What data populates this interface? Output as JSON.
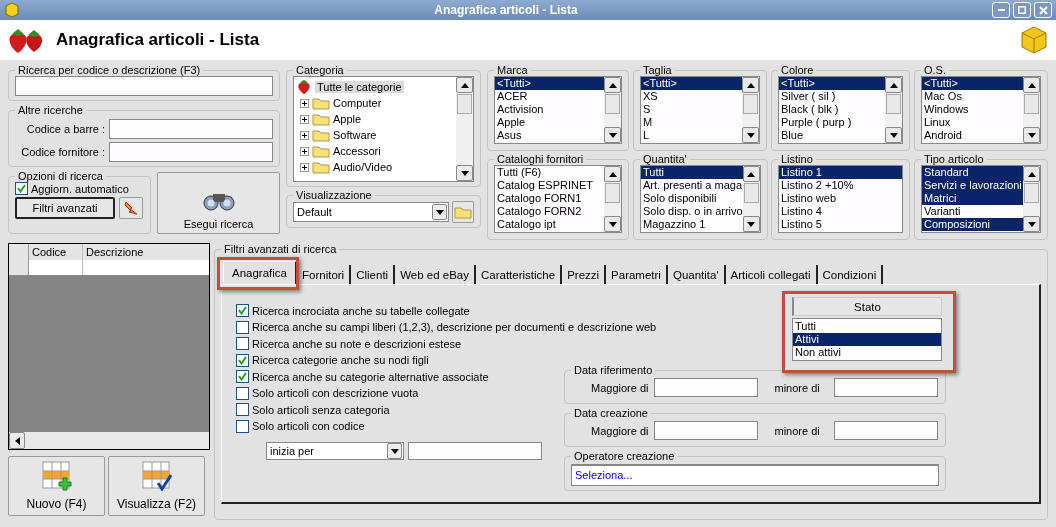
{
  "window": {
    "title": "Anagrafica articoli  - Lista"
  },
  "header": {
    "title": "Anagrafica articoli  - Lista"
  },
  "search": {
    "label": "Ricerca per codice o descrizione (F3)"
  },
  "other_searches": {
    "label": "Altre ricerche",
    "fields": [
      {
        "label": "Codice a barre :"
      },
      {
        "label": "Codice fornitore :"
      }
    ]
  },
  "options": {
    "label": "Opzioni di ricerca",
    "auto_update": {
      "label": "Aggiorn. automatico",
      "checked": true
    },
    "filters_button": "Filtri avanzati"
  },
  "run_button": "Esegui ricerca",
  "category": {
    "label": "Categoria",
    "root": {
      "label": "Tutte le categorie",
      "selected": true
    },
    "children": [
      {
        "label": "Computer",
        "expanded": false
      },
      {
        "label": "Apple",
        "expanded": false
      },
      {
        "label": "Software",
        "expanded": false
      },
      {
        "label": "Accessori",
        "expanded": false
      },
      {
        "label": "Audio/Video",
        "expanded": false
      }
    ]
  },
  "view": {
    "label": "Visualizzazione",
    "value": "Default"
  },
  "lists": [
    {
      "label": "Marca",
      "scrollable": true,
      "items": [
        {
          "label": "<Tutti>",
          "selected": true
        },
        {
          "label": "ACER",
          "selected": false
        },
        {
          "label": "Activision",
          "selected": false
        },
        {
          "label": "Apple",
          "selected": false
        },
        {
          "label": "Asus",
          "selected": false
        }
      ]
    },
    {
      "label": "Taglia",
      "scrollable": true,
      "items": [
        {
          "label": "<Tutti>",
          "selected": true
        },
        {
          "label": "XS",
          "selected": false
        },
        {
          "label": "S",
          "selected": false
        },
        {
          "label": "M",
          "selected": false
        },
        {
          "label": "L",
          "selected": false
        }
      ]
    },
    {
      "label": "Colore",
      "scrollable": true,
      "items": [
        {
          "label": "<Tutti>",
          "selected": true
        },
        {
          "label": "Silver ( sil )",
          "selected": false
        },
        {
          "label": "Black ( blk )",
          "selected": false
        },
        {
          "label": "Purple ( purp )",
          "selected": false
        },
        {
          "label": "Blue",
          "selected": false
        }
      ]
    },
    {
      "label": "O.S.",
      "scrollable": true,
      "items": [
        {
          "label": "<Tutti>",
          "selected": true
        },
        {
          "label": "Mac Os",
          "selected": false
        },
        {
          "label": "Windows",
          "selected": false
        },
        {
          "label": "Linux",
          "selected": false
        },
        {
          "label": "Android",
          "selected": false
        }
      ]
    },
    {
      "label": "Cataloghi fornitori",
      "scrollable": true,
      "items": [
        {
          "label": "Tutti (F6)",
          "selected": false
        },
        {
          "label": "Catalog ESPRINET",
          "selected": false
        },
        {
          "label": "Catalogo FORN1",
          "selected": false
        },
        {
          "label": "Catalogo FORN2",
          "selected": false
        },
        {
          "label": "Catalogo ipt",
          "selected": false
        }
      ]
    },
    {
      "label": "Quantita'",
      "scrollable": true,
      "items": [
        {
          "label": "Tutti",
          "selected": true
        },
        {
          "label": "Art. presenti a maga",
          "selected": false
        },
        {
          "label": "Solo disponibili",
          "selected": false
        },
        {
          "label": "Solo disp. o in arrivo",
          "selected": false
        },
        {
          "label": "Magazzino 1",
          "selected": false
        }
      ]
    },
    {
      "label": "Listino",
      "scrollable": false,
      "items": [
        {
          "label": "Listino 1",
          "selected": true
        },
        {
          "label": "Listino 2 +10%",
          "selected": false
        },
        {
          "label": "Listino web",
          "selected": false
        },
        {
          "label": "Listino 4",
          "selected": false
        },
        {
          "label": "Listino 5",
          "selected": false
        }
      ]
    },
    {
      "label": "Tipo articolo",
      "scrollable": true,
      "items": [
        {
          "label": "Standard",
          "selected": true
        },
        {
          "label": "Servizi e lavorazioni",
          "selected": true
        },
        {
          "label": "Matrici",
          "selected": true
        },
        {
          "label": "Varianti",
          "selected": false
        },
        {
          "label": "Composizioni",
          "selected": true
        }
      ]
    }
  ],
  "grid": {
    "columns": [
      "Codice",
      "Descrizione"
    ]
  },
  "buttons": [
    {
      "kind": "new",
      "label": "Nuovo (F4)"
    },
    {
      "kind": "view",
      "label": "Visualizza (F2)"
    }
  ],
  "advanced": {
    "label": "Filtri avanzati di ricerca",
    "tabs": [
      {
        "label": "Anagrafica",
        "selected": true,
        "highlighted": true
      },
      {
        "label": "Fornitori",
        "selected": false,
        "highlighted": false
      },
      {
        "label": "Clienti",
        "selected": false,
        "highlighted": false
      },
      {
        "label": "Web ed eBay",
        "selected": false,
        "highlighted": false
      },
      {
        "label": "Caratteristiche",
        "selected": false,
        "highlighted": false
      },
      {
        "label": "Prezzi",
        "selected": false,
        "highlighted": false
      },
      {
        "label": "Parametri",
        "selected": false,
        "highlighted": false
      },
      {
        "label": "Quantita'",
        "selected": false,
        "highlighted": false
      },
      {
        "label": "Articoli collegati",
        "selected": false,
        "highlighted": false
      },
      {
        "label": "Condizioni",
        "selected": false,
        "highlighted": false
      }
    ],
    "checks": [
      {
        "label": "Ricerca incrociata anche su tabelle collegate",
        "checked": true
      },
      {
        "label": "Ricerca anche su campi liberi (1,2,3), descrizione per documenti e descrizione web",
        "checked": false
      },
      {
        "label": "Ricerca anche su note e descrizioni estese",
        "checked": false
      },
      {
        "label": "Ricerca categorie anche su nodi figli",
        "checked": true
      },
      {
        "label": "Ricerca anche su categorie alternative associate",
        "checked": true
      },
      {
        "label": "Solo articoli con descrizione vuota",
        "checked": false
      },
      {
        "label": "Solo articoli senza categoria",
        "checked": false
      },
      {
        "label": "Solo articoli con codice",
        "checked": false
      }
    ],
    "match": {
      "value": "inizia per"
    },
    "stato": {
      "header": "Stato",
      "highlighted": true,
      "items": [
        {
          "label": "Tutti",
          "selected": false
        },
        {
          "label": "Attivi",
          "selected": true
        },
        {
          "label": "Non attivi",
          "selected": false
        }
      ]
    },
    "date_groups": [
      {
        "label": "Data riferimento",
        "from": "Maggiore di",
        "to": "minore di"
      },
      {
        "label": "Data creazione",
        "from": "Maggiore di",
        "to": "minore di"
      }
    ],
    "operator": {
      "label": "Operatore creazione",
      "value": "Seleziona..."
    }
  }
}
